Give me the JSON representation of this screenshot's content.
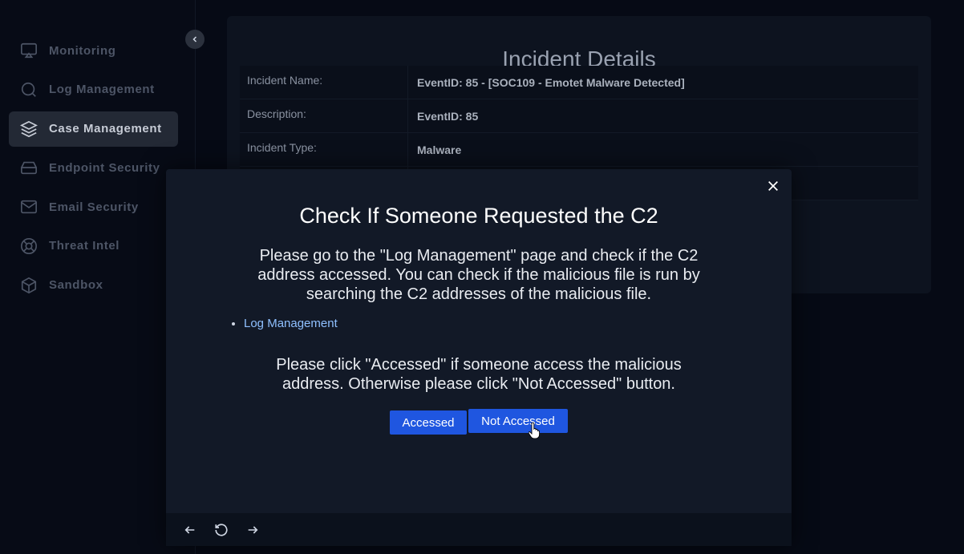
{
  "sidebar": {
    "items": [
      {
        "label": "Monitoring",
        "icon": "monitor-icon",
        "active": false
      },
      {
        "label": "Log Management",
        "icon": "search-icon",
        "active": false
      },
      {
        "label": "Case Management",
        "icon": "layers-icon",
        "active": true
      },
      {
        "label": "Endpoint Security",
        "icon": "drive-icon",
        "active": false
      },
      {
        "label": "Email Security",
        "icon": "mail-icon",
        "active": false
      },
      {
        "label": "Threat Intel",
        "icon": "lifebuoy-icon",
        "active": false
      },
      {
        "label": "Sandbox",
        "icon": "cube-icon",
        "active": false
      }
    ]
  },
  "incident": {
    "title": "Incident Details",
    "rows": [
      {
        "key": "Incident Name:",
        "value": "EventID: 85 - [SOC109 - Emotet Malware Detected]"
      },
      {
        "key": "Description:",
        "value": "EventID: 85"
      },
      {
        "key": "Incident Type:",
        "value": "Malware"
      },
      {
        "key": "",
        "value": ""
      }
    ]
  },
  "modal": {
    "title": "Check If Someone Requested the C2",
    "text1": "Please go to the \"Log Management\" page and check if the C2 address accessed. You can check if the malicious file is run by searching the C2 addresses of the malicious file.",
    "link_label": "Log Management",
    "text2": "Please click \"Accessed\" if someone access the malicious address. Otherwise please click \"Not Accessed\" button.",
    "accessed_label": "Accessed",
    "not_accessed_label": "Not Accessed"
  },
  "colors": {
    "accent": "#1f56e0",
    "background": "#060a15",
    "modal_bg": "#121927"
  }
}
